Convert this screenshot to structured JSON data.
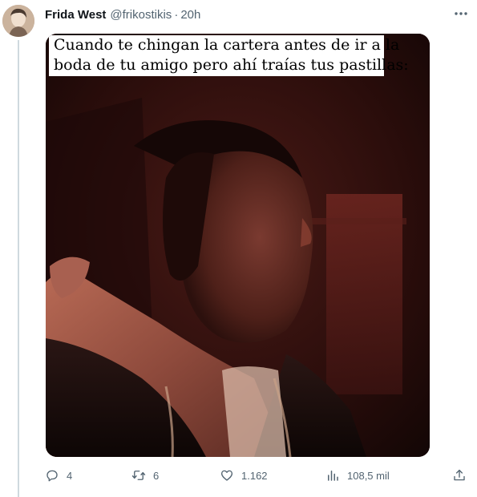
{
  "tweet": {
    "author": {
      "display_name": "Frida West",
      "handle": "@frikostikis",
      "separator": "·",
      "time": "20h"
    },
    "meme": {
      "caption_line1": "Cuando te chingan la cartera antes de ir a la",
      "caption_line2": "boda de tu amigo pero ahí traías tus pastillas:"
    },
    "actions": {
      "replies": "4",
      "retweets": "6",
      "likes": "1.162",
      "views": "108,5 mil"
    },
    "icons": {
      "more": "more-horizontal-icon",
      "reply": "reply-icon",
      "retweet": "retweet-icon",
      "like": "heart-icon",
      "views": "analytics-icon",
      "share": "share-icon"
    },
    "colors": {
      "text": "#0f1419",
      "secondary": "#536471",
      "thread_line": "#cfd9de"
    }
  }
}
